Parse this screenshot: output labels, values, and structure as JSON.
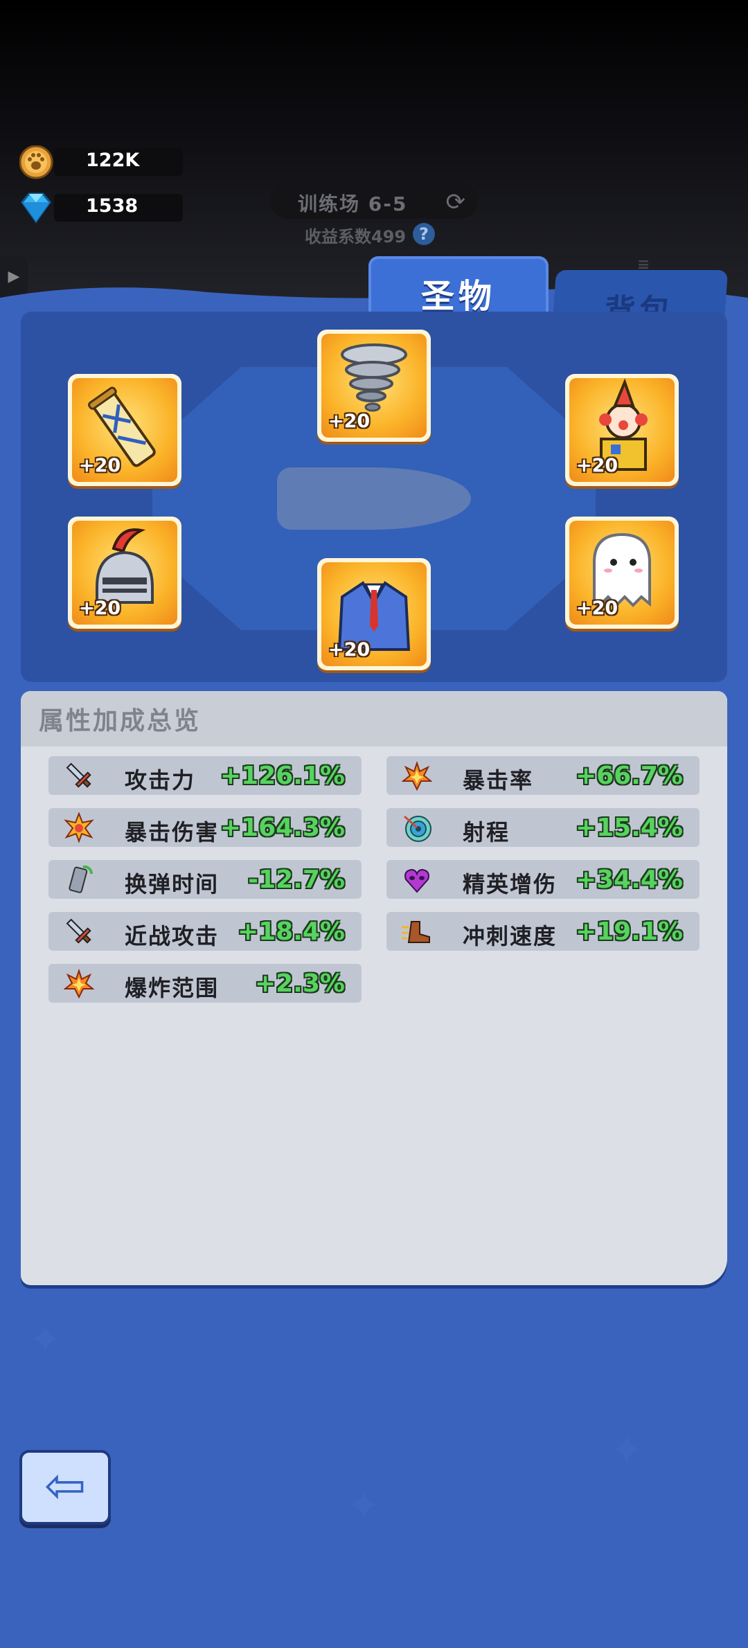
{
  "currency": {
    "coins": {
      "icon": "paw-coin-icon",
      "value": "122K"
    },
    "gems": {
      "icon": "diamond-icon",
      "value": "1538"
    }
  },
  "stage": {
    "label": "训练场 6-5",
    "coefficient": "收益系数499",
    "help": "?"
  },
  "tabs": {
    "relics": "圣物",
    "backpack": "背包"
  },
  "relics": [
    {
      "name": "scroll-relic",
      "level": "+20"
    },
    {
      "name": "tornado-relic",
      "level": "+20"
    },
    {
      "name": "clown-box-relic",
      "level": "+20"
    },
    {
      "name": "knight-helmet-relic",
      "level": "+20"
    },
    {
      "name": "suit-relic",
      "level": "+20"
    },
    {
      "name": "ghost-relic",
      "level": "+20"
    }
  ],
  "stats": {
    "title": "属性加成总览",
    "left": [
      {
        "icon": "sword-icon",
        "name": "攻击力",
        "value": "+126.1%"
      },
      {
        "icon": "crit-burst-icon",
        "name": "暴击伤害",
        "value": "+164.3%"
      },
      {
        "icon": "magazine-icon",
        "name": "换弹时间",
        "value": "-12.7%"
      },
      {
        "icon": "sword-icon",
        "name": "近战攻击",
        "value": "+18.4%"
      },
      {
        "icon": "explosion-icon",
        "name": "爆炸范围",
        "value": "+2.3%"
      }
    ],
    "right": [
      {
        "icon": "explosion-icon",
        "name": "暴击率",
        "value": "+66.7%"
      },
      {
        "icon": "target-range-icon",
        "name": "射程",
        "value": "+15.4%"
      },
      {
        "icon": "heart-mask-icon",
        "name": "精英增伤",
        "value": "+34.4%"
      },
      {
        "icon": "dash-boot-icon",
        "name": "冲刺速度",
        "value": "+19.1%"
      }
    ]
  },
  "colors": {
    "accent_green": "#57d35f",
    "panel_blue": "#3a63be",
    "tab_blue": "#3c70d6"
  }
}
